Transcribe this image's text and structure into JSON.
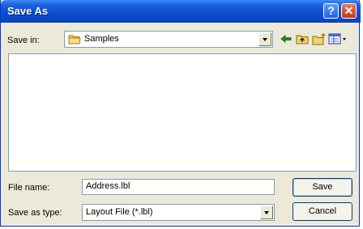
{
  "window": {
    "title": "Save As"
  },
  "title_buttons": {
    "help": "?",
    "close": "✕"
  },
  "save_in": {
    "label": "Save in:",
    "value": "Samples"
  },
  "toolbar": {
    "back_icon": "back-arrow-icon",
    "up_icon": "up-folder-icon",
    "new_folder_icon": "new-folder-icon",
    "view_menu_icon": "view-menu-icon"
  },
  "file_name": {
    "label": "File name:",
    "value": "Address.lbl"
  },
  "save_as_type": {
    "label": "Save as type:",
    "value": "Layout File (*.lbl)"
  },
  "buttons": {
    "save": "Save",
    "cancel": "Cancel"
  }
}
